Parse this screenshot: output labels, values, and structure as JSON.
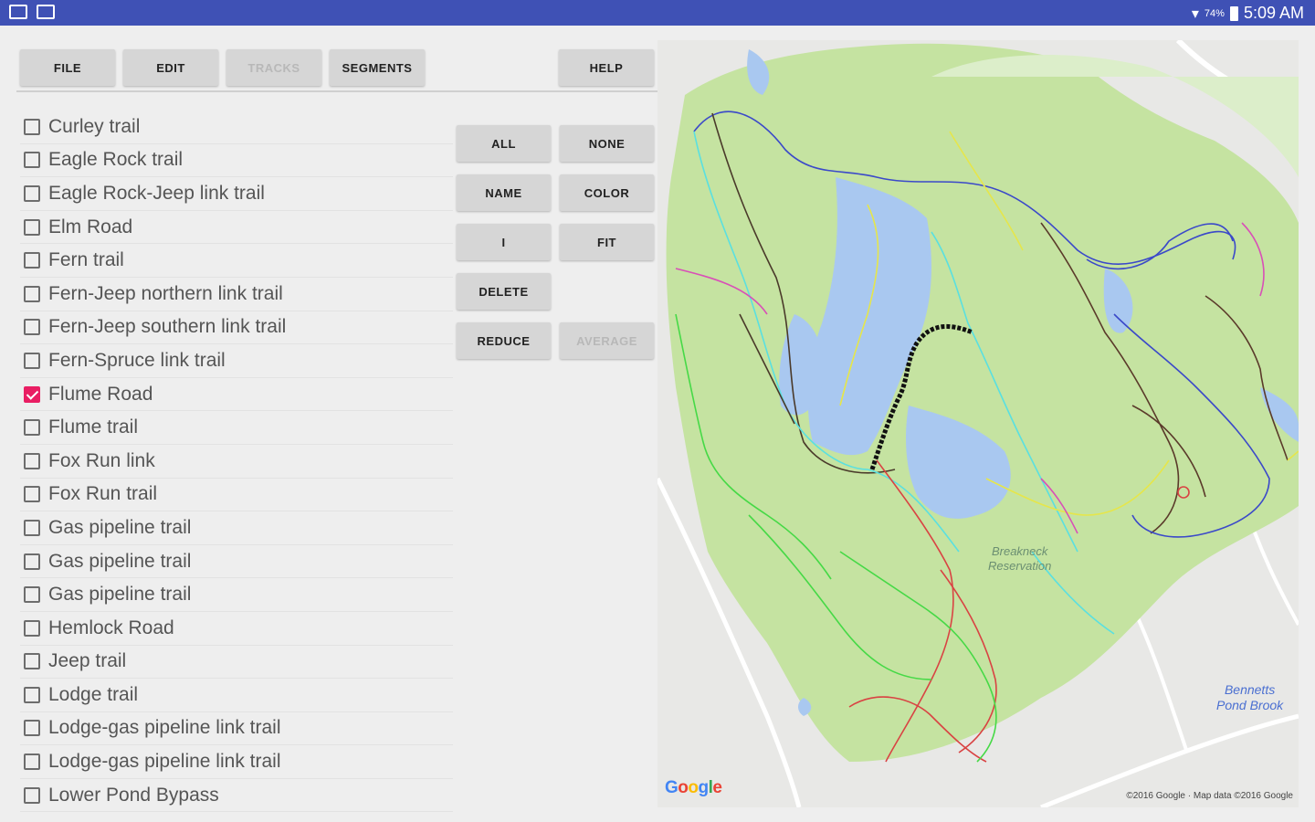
{
  "status_bar": {
    "battery": "74%",
    "time": "5:09 AM",
    "left_icons": [
      "screen-cast-icon",
      "gallery-icon"
    ],
    "right_icons": [
      "wifi-icon",
      "battery-icon"
    ]
  },
  "toolbar": {
    "file": "FILE",
    "edit": "EDIT",
    "tracks": "TRACKS",
    "segments": "SEGMENTS",
    "help": "HELP"
  },
  "actions": {
    "all": "ALL",
    "none": "NONE",
    "name": "NAME",
    "color": "COLOR",
    "info": "I",
    "fit": "FIT",
    "delete": "DELETE",
    "reduce": "REDUCE",
    "average": "AVERAGE"
  },
  "trails": [
    {
      "label": "Curley trail",
      "checked": false
    },
    {
      "label": "Eagle Rock trail",
      "checked": false
    },
    {
      "label": "Eagle Rock-Jeep link trail",
      "checked": false
    },
    {
      "label": "Elm Road",
      "checked": false
    },
    {
      "label": "Fern trail",
      "checked": false
    },
    {
      "label": "Fern-Jeep northern link trail",
      "checked": false
    },
    {
      "label": "Fern-Jeep southern link trail",
      "checked": false
    },
    {
      "label": "Fern-Spruce link trail",
      "checked": false
    },
    {
      "label": "Flume Road",
      "checked": true
    },
    {
      "label": "Flume trail",
      "checked": false
    },
    {
      "label": "Fox Run link",
      "checked": false
    },
    {
      "label": "Fox Run trail",
      "checked": false
    },
    {
      "label": "Gas pipeline trail",
      "checked": false
    },
    {
      "label": "Gas pipeline trail",
      "checked": false
    },
    {
      "label": "Gas pipeline trail",
      "checked": false
    },
    {
      "label": "Hemlock Road",
      "checked": false
    },
    {
      "label": "Jeep trail",
      "checked": false
    },
    {
      "label": "Lodge trail",
      "checked": false
    },
    {
      "label": "Lodge-gas pipeline link trail",
      "checked": false
    },
    {
      "label": "Lodge-gas pipeline link trail",
      "checked": false
    },
    {
      "label": "Lower Pond Bypass",
      "checked": false
    }
  ],
  "map": {
    "reservation_label": "Breakneck\nReservation",
    "water_label": "Bennetts\nPond Brook",
    "google_logo": "Google",
    "copyright": "©2016 Google · Map data ©2016 Google",
    "colors": {
      "park": "#c5e3a1",
      "water": "#a9c8f0",
      "accent": "#e91e63",
      "statusbar": "#3f51b5"
    }
  }
}
